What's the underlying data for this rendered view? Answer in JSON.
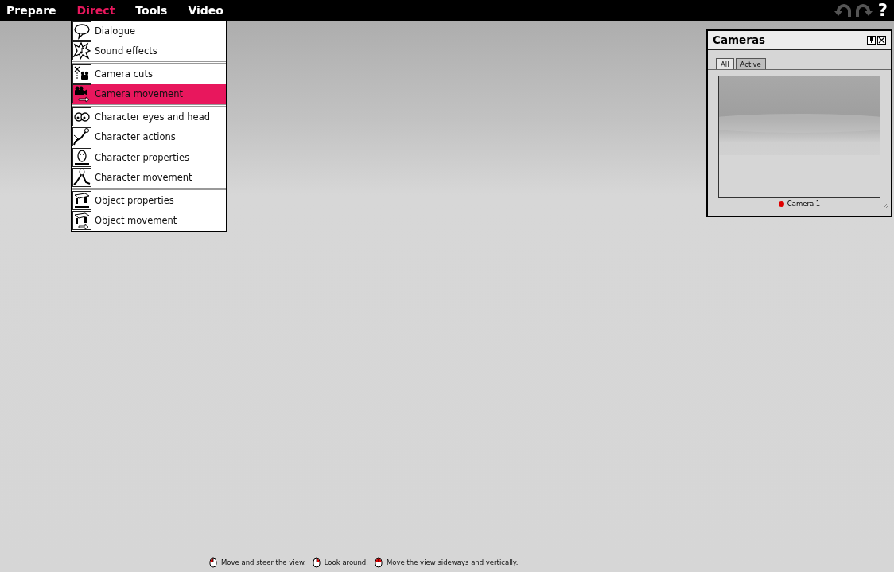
{
  "menubar": [
    {
      "label": "Prepare",
      "selected": false
    },
    {
      "label": "Direct",
      "selected": true
    },
    {
      "label": "Tools",
      "selected": false
    },
    {
      "label": "Video",
      "selected": false
    }
  ],
  "help": "?",
  "menu": {
    "groups": [
      [
        {
          "label": "Dialogue",
          "selected": false
        },
        {
          "label": "Sound effects",
          "selected": false
        }
      ],
      [
        {
          "label": "Camera cuts",
          "selected": false
        },
        {
          "label": "Camera movement",
          "selected": true
        }
      ],
      [
        {
          "label": "Character eyes and head",
          "selected": false
        },
        {
          "label": "Character actions",
          "selected": false
        },
        {
          "label": "Character properties",
          "selected": false
        },
        {
          "label": "Character movement",
          "selected": false
        }
      ],
      [
        {
          "label": "Object properties",
          "selected": false
        },
        {
          "label": "Object movement",
          "selected": false
        }
      ]
    ]
  },
  "cameras_panel": {
    "title": "Cameras",
    "tabs": [
      {
        "label": "All",
        "selected": true
      },
      {
        "label": "Active",
        "selected": false
      }
    ],
    "cameras": [
      {
        "name": "Camera 1",
        "color": "#e00000"
      }
    ]
  },
  "hints": [
    {
      "kind": "left",
      "text": "Move and steer the view."
    },
    {
      "kind": "right",
      "text": "Look around."
    },
    {
      "kind": "both",
      "text": "Move the view sideways and vertically."
    }
  ]
}
